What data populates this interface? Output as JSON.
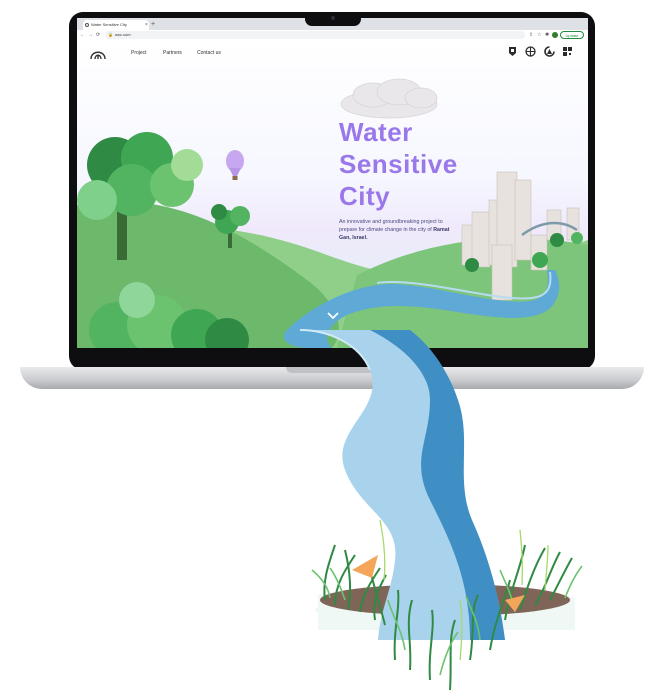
{
  "browser": {
    "tab_title": "Water Sensitive City",
    "tab_close": "×",
    "new_tab": "+",
    "url": "wsc.com",
    "update_label": "Update"
  },
  "site": {
    "nav": [
      {
        "label": "Project"
      },
      {
        "label": "Partners"
      },
      {
        "label": "Contact us"
      }
    ],
    "hero_title": [
      "Water",
      "Sensitive",
      "City"
    ],
    "tagline_part1": "An innovative and groundbreaking project to prepare for climate change in the city of ",
    "tagline_city": "Ramat Gan, Israel.",
    "scroll_icon": "chevron-down-icon",
    "partner_logos": [
      "partner-logo-1",
      "partner-logo-2",
      "partner-logo-3",
      "partner-logo-4"
    ]
  },
  "colors": {
    "title": "#9a78ea",
    "river_light": "#a9d3ec",
    "river_dark": "#3f8fc4",
    "grass": "#6fbf6d"
  }
}
